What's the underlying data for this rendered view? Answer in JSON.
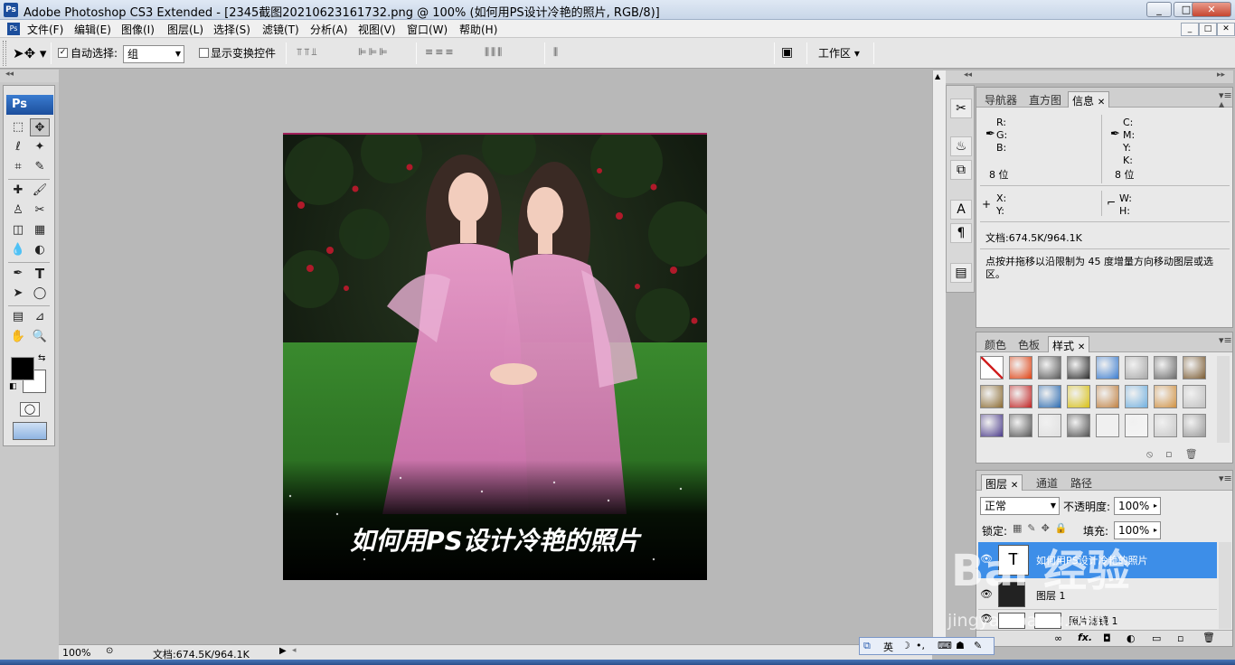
{
  "titlebar": {
    "app_icon": "Ps",
    "title": "Adobe Photoshop CS3 Extended - [2345截图20210623161732.png @ 100% (如何用PS设计冷艳的照片, RGB/8)]",
    "minimize": "_",
    "restore": "□",
    "close": "✕"
  },
  "menubar": {
    "doc_icon": "Ps",
    "items": [
      "文件(F)",
      "编辑(E)",
      "图像(I)",
      "图层(L)",
      "选择(S)",
      "滤镜(T)",
      "分析(A)",
      "视图(V)",
      "窗口(W)",
      "帮助(H)"
    ],
    "doc_minimize": "_",
    "doc_restore": "□",
    "doc_close": "✕"
  },
  "options": {
    "auto_select_checked": true,
    "auto_select_label": "自动选择:",
    "auto_select_value": "组",
    "show_transform_label": "显示变换控件",
    "show_transform_checked": false,
    "workspace_label": "工作区 ▾"
  },
  "toolbox": {
    "logo": "Ps",
    "tools": [
      "⬚",
      "✥",
      "ℓ",
      "✦",
      "⌗",
      "✎",
      "✚",
      "🖌",
      "♙",
      "✂",
      "◫",
      "▦",
      "💧",
      "◐",
      "✒",
      "T",
      "➤",
      "◯",
      "▤",
      "⊿",
      "✋",
      "🔍"
    ],
    "foreground_color": "#000000",
    "background_color": "#ffffff"
  },
  "canvas": {
    "caption": "如何用PS设计冷艳的照片",
    "watermark": "Bai 经验",
    "watermark_url": "jingyan.baidu.com"
  },
  "info_panel": {
    "tabs": [
      "导航器",
      "直方图",
      "信息"
    ],
    "active_tab": "信息",
    "rgb_labels": [
      "R:",
      "G:",
      "B:"
    ],
    "cmyk_labels": [
      "C:",
      "M:",
      "Y:",
      "K:"
    ],
    "bit_left": "8 位",
    "bit_right": "8 位",
    "xy_labels": [
      "X:",
      "Y:"
    ],
    "wh_labels": [
      "W:",
      "H:"
    ],
    "doc_size": "文档:674.5K/964.1K",
    "hint": "点按并拖移以沿限制为 45 度增量方向移动图层或选区。"
  },
  "styles_panel": {
    "tabs": [
      "颜色",
      "色板",
      "样式"
    ],
    "active_tab": "样式",
    "swatches": [
      "#ffffff",
      "#e04010",
      "#555555",
      "#2a2a2a",
      "#3a7cd0",
      "#a8a8a8",
      "#6a6a6a",
      "#7a5a30",
      "#8a6a30",
      "#c02020",
      "#2a6ab0",
      "#d8c010",
      "#c08040",
      "#70b0e0",
      "#d09040",
      "#c0c0c0",
      "#4a3a8a",
      "#555555",
      "#e0e0e0",
      "#505050",
      "#f0f0f0",
      "#f5f5f5",
      "#c8c8c8",
      "#9a9a9a"
    ]
  },
  "layers_panel": {
    "tabs": [
      "图层",
      "通道",
      "路径"
    ],
    "active_tab": "图层",
    "blend_mode": "正常",
    "opacity_label": "不透明度:",
    "opacity_value": "100%",
    "lock_label": "锁定:",
    "fill_label": "填充:",
    "fill_value": "100%",
    "layers": [
      {
        "name": "如何用PS设计冷艳的照片",
        "thumb": "T",
        "selected": true
      },
      {
        "name": "图层 1",
        "thumb": "",
        "selected": false
      },
      {
        "name": "照片滤镜 1",
        "thumb": "",
        "selected": false
      }
    ],
    "footer_icons": [
      "∞",
      "fx.",
      "◘",
      "◐",
      "▭",
      "▫",
      "🗑"
    ]
  },
  "status": {
    "zoom": "100%",
    "doc_size": "文档:674.5K/964.1K"
  },
  "ime": {
    "lang": "英"
  }
}
